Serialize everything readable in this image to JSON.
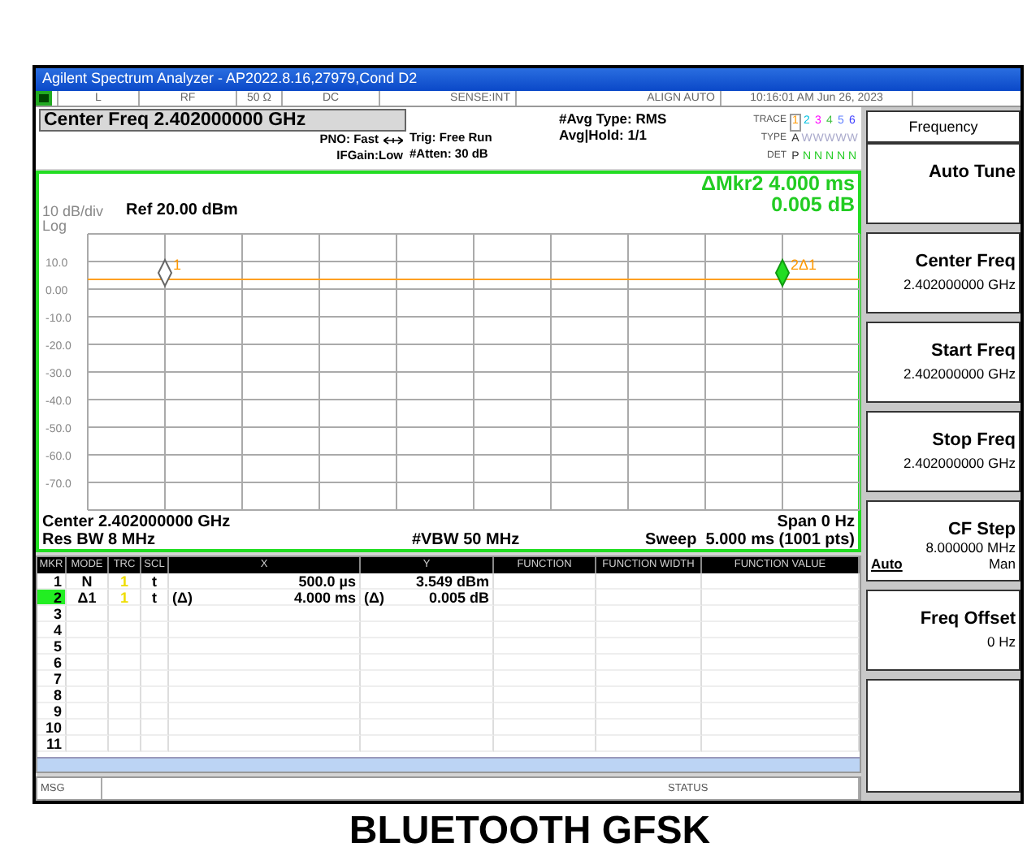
{
  "window": {
    "title": "Agilent Spectrum Analyzer - AP2022.8.16,27979,Cond D2"
  },
  "status_strip": [
    "L",
    "RF",
    "50 Ω",
    "DC",
    "SENSE:INT",
    "ALIGN AUTO",
    "10:16:01 AM Jun 26, 2023"
  ],
  "settings": {
    "center_freq": "Center Freq 2.402000000 GHz",
    "pno": "PNO: Fast",
    "ifgain": "IFGain:Low",
    "trig": "Trig: Free Run",
    "atten": "#Atten: 30 dB",
    "avg_type": "#Avg Type: RMS",
    "avg_hold": "Avg|Hold: 1/1"
  },
  "trace_legend": {
    "trace_label": "TRACE",
    "type_label": "TYPE",
    "det_label": "DET",
    "traces": [
      {
        "number": "1",
        "color": "#ff9900",
        "selected": true,
        "type": "A",
        "det": "P"
      },
      {
        "number": "2",
        "color": "#00c0e0",
        "selected": false,
        "type": "W",
        "det": "N"
      },
      {
        "number": "3",
        "color": "#ff00ff",
        "selected": false,
        "type": "W",
        "det": "N"
      },
      {
        "number": "4",
        "color": "#40c040",
        "selected": false,
        "type": "W",
        "det": "N"
      },
      {
        "number": "5",
        "color": "#6080ff",
        "selected": false,
        "type": "W",
        "det": "N"
      },
      {
        "number": "6",
        "color": "#4040ff",
        "selected": false,
        "type": "W",
        "det": "N"
      }
    ]
  },
  "graph": {
    "marker_readout": [
      "ΔMkr2 4.000 ms",
      "0.005 dB"
    ],
    "scale": "10 dB/div",
    "ref": "Ref 20.00 dBm",
    "log": "Log",
    "y_labels": [
      "10.0",
      "0.00",
      "-10.0",
      "-20.0",
      "-30.0",
      "-40.0",
      "-50.0",
      "-60.0",
      "-70.0"
    ],
    "markers": [
      {
        "kind": "normal",
        "label": "1"
      },
      {
        "kind": "delta",
        "label": "2Δ1"
      }
    ],
    "center": "Center 2.402000000 GHz",
    "span": "Span 0 Hz",
    "rbw": "Res BW 8 MHz",
    "vbw": "#VBW 50 MHz",
    "sweep": "Sweep  5.000 ms (1001 pts)"
  },
  "marker_table": {
    "columns": [
      "MKR",
      "MODE",
      "TRC",
      "SCL",
      "X",
      "Y",
      "FUNCTION",
      "FUNCTION WIDTH",
      "FUNCTION VALUE"
    ],
    "rows": [
      {
        "mkr": "1",
        "selected": false,
        "mode": "N",
        "trc": "1",
        "scl": "t",
        "x_prefix": "",
        "x": "500.0 µs",
        "y_prefix": "",
        "y": "3.549 dBm"
      },
      {
        "mkr": "2",
        "selected": true,
        "mode": "Δ1",
        "trc": "1",
        "scl": "t",
        "x_prefix": "(Δ)",
        "x": "4.000 ms",
        "y_prefix": "(Δ)",
        "y": "0.005 dB"
      },
      {
        "mkr": "3",
        "selected": false
      },
      {
        "mkr": "4",
        "selected": false
      },
      {
        "mkr": "5",
        "selected": false
      },
      {
        "mkr": "6",
        "selected": false
      },
      {
        "mkr": "7",
        "selected": false
      },
      {
        "mkr": "8",
        "selected": false
      },
      {
        "mkr": "9",
        "selected": false
      },
      {
        "mkr": "10",
        "selected": false
      },
      {
        "mkr": "11",
        "selected": false
      }
    ]
  },
  "message_bar": {
    "msg": "MSG",
    "status": "STATUS"
  },
  "softkeys": [
    {
      "kind": "title",
      "label": "Frequency"
    },
    {
      "kind": "key",
      "label": "Auto Tune"
    },
    {
      "kind": "key",
      "label": "Center Freq",
      "value": "2.402000000 GHz"
    },
    {
      "kind": "key",
      "label": "Start Freq",
      "value": "2.402000000 GHz"
    },
    {
      "kind": "key",
      "label": "Stop Freq",
      "value": "2.402000000 GHz"
    },
    {
      "kind": "toggle",
      "label": "CF Step",
      "value": "8.000000 MHz",
      "options": [
        {
          "label": "Auto",
          "selected": true
        },
        {
          "label": "Man",
          "selected": false
        }
      ]
    },
    {
      "kind": "key",
      "label": "Freq Offset",
      "value": "0 Hz"
    },
    {
      "kind": "empty"
    }
  ],
  "caption": "BLUETOOTH GFSK"
}
